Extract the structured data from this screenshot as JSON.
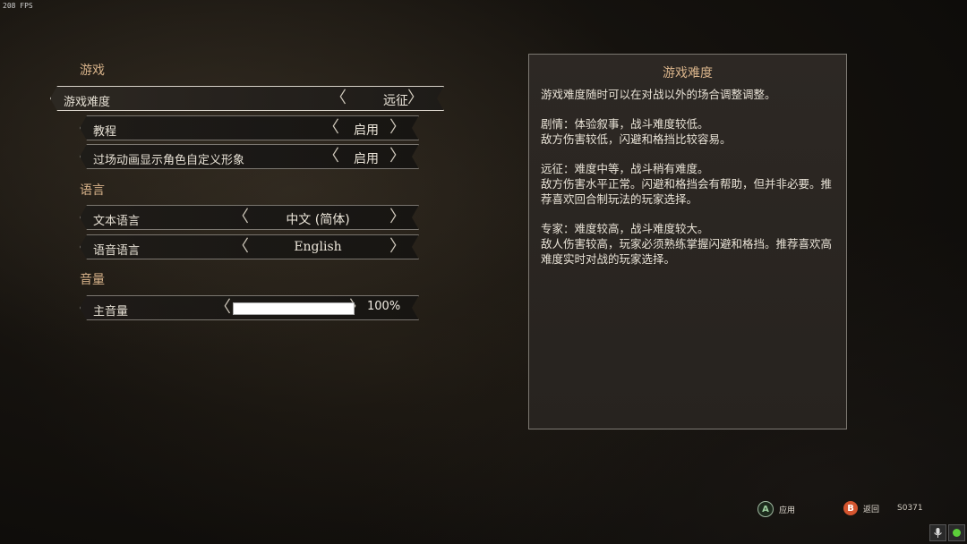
{
  "fps": "208 FPS",
  "sections": {
    "game": "游戏",
    "language": "语言",
    "volume": "音量"
  },
  "settings": {
    "difficulty": {
      "label": "游戏难度",
      "value": "远征"
    },
    "tutorial": {
      "label": "教程",
      "value": "启用"
    },
    "cutscene": {
      "label": "过场动画显示角色自定义形象",
      "value": "启用"
    },
    "text_language": {
      "label": "文本语言",
      "value": "中文 (简体)"
    },
    "voice_language": {
      "label": "语音语言",
      "value": "English"
    },
    "master_volume": {
      "label": "主音量",
      "value": "100%",
      "level": 1.0
    }
  },
  "info_panel": {
    "title": "游戏难度",
    "paragraphs": [
      "游戏难度随时可以在对战以外的场合调整调整。",
      "剧情：体验叙事，战斗难度较低。\n敌方伤害较低，闪避和格挡比较容易。",
      "远征：难度中等，战斗稍有难度。\n敌方伤害水平正常。闪避和格挡会有帮助，但并非必要。推荐喜欢回合制玩法的玩家选择。",
      "专家：难度较高，战斗难度较大。\n敌人伤害较高，玩家必须熟练掌握闪避和格挡。推荐喜欢高难度实时对战的玩家选择。"
    ]
  },
  "hints": {
    "a_key": "A",
    "a_label": "应用",
    "b_key": "B",
    "b_label": "返回",
    "code": "S0371"
  },
  "arrows": {
    "left": "〈",
    "right": "〉"
  },
  "colors": {
    "accent": "#d8b38a",
    "b_button": "#d4552f",
    "tray_green": "#5ccf3a"
  }
}
